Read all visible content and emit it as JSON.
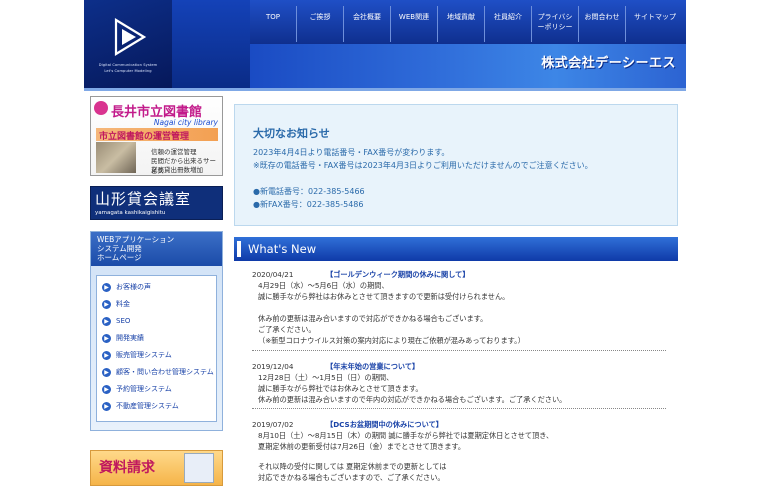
{
  "header": {
    "logo": {
      "line1": "Digital Communication System",
      "line2": "Let's Computer Modeling"
    },
    "company_name": "株式会社デーシーエス",
    "nav": [
      "TOP",
      "ご挨拶",
      "会社概要",
      "WEB関連",
      "地域貢献",
      "社員紹介",
      "プライバシーポリシー",
      "お問合わせ",
      "サイトマップ"
    ]
  },
  "sidebar": {
    "library_banner": {
      "title": "長井市立図書館",
      "subtitle": "Nagai city library",
      "strip": "市立図書館の運営管理",
      "lines": [
        "信頼の運営管理",
        "民間だから出来るサービス",
        "業務貸出冊数増加"
      ]
    },
    "yamagata_banner": {
      "title": "山形貸会議室",
      "subtitle": "yamagata kashikaigishitu"
    },
    "menu": {
      "heading": [
        "WEBアプリケーション",
        "システム開発",
        "ホームページ"
      ],
      "items": [
        "お客様の声",
        "料金",
        "SEO",
        "開発実績",
        "販売管理システム",
        "顧客・問い合わせ管理システム",
        "予約管理システム",
        "不動産管理システム"
      ]
    },
    "doc_banner": {
      "title": "資料請求"
    }
  },
  "notice": {
    "title": "大切なお知らせ",
    "lines": [
      "2023年4月4日より電話番号・FAX番号が変わります。",
      "※既存の電話番号・FAX番号は2023年4月3日よりご利用いただけませんのでご注意ください。",
      "●新電話番号：022-385-5466",
      "●新FAX番号：022-385-5486"
    ]
  },
  "whats_new": {
    "heading": "What's New",
    "items": [
      {
        "date": "2020/04/21",
        "title": "【ゴールデンウィーク期間の休みに関して】",
        "lines": [
          "4月29日（水）～5月6日（水）の期間、",
          "誠に勝手ながら弊社はお休みとさせて頂きますので更新は受付けられません。",
          "",
          "休み前の更新は混み合いますので対応ができかねる場合もございます。",
          "ご了承ください。",
          "（※新型コロナウイルス対策の案内対応により現在ご依頼が混みあっております。）"
        ]
      },
      {
        "date": "2019/12/04",
        "title": "【年末年始の営業について】",
        "lines": [
          "12月28日（土）～1月5日（日）の期間、",
          "誠に勝手ながら弊社ではお休みとさせて頂きます。",
          "休み前の更新は混み合いますので年内の対応ができかねる場合もございます。ご了承ください。"
        ]
      },
      {
        "date": "2019/07/02",
        "title": "【DCSお盆期間中の休みについて】",
        "lines": [
          "8月10日（土）～8月15日（木）の期間 誠に勝手ながら弊社では夏期定休日とさせて頂き、",
          "夏期定休前の更新受付は7月26日（金）までとさせて頂きます。",
          "",
          "それ以降の受付に関しては 夏期定休前までの更新としては",
          "対応できかねる場合もございますので、ご了承ください。"
        ]
      }
    ]
  },
  "colors": {
    "nav_blue": "#0f2f8e",
    "accent_blue": "#2a6aaa",
    "pink": "#c21a8a"
  }
}
